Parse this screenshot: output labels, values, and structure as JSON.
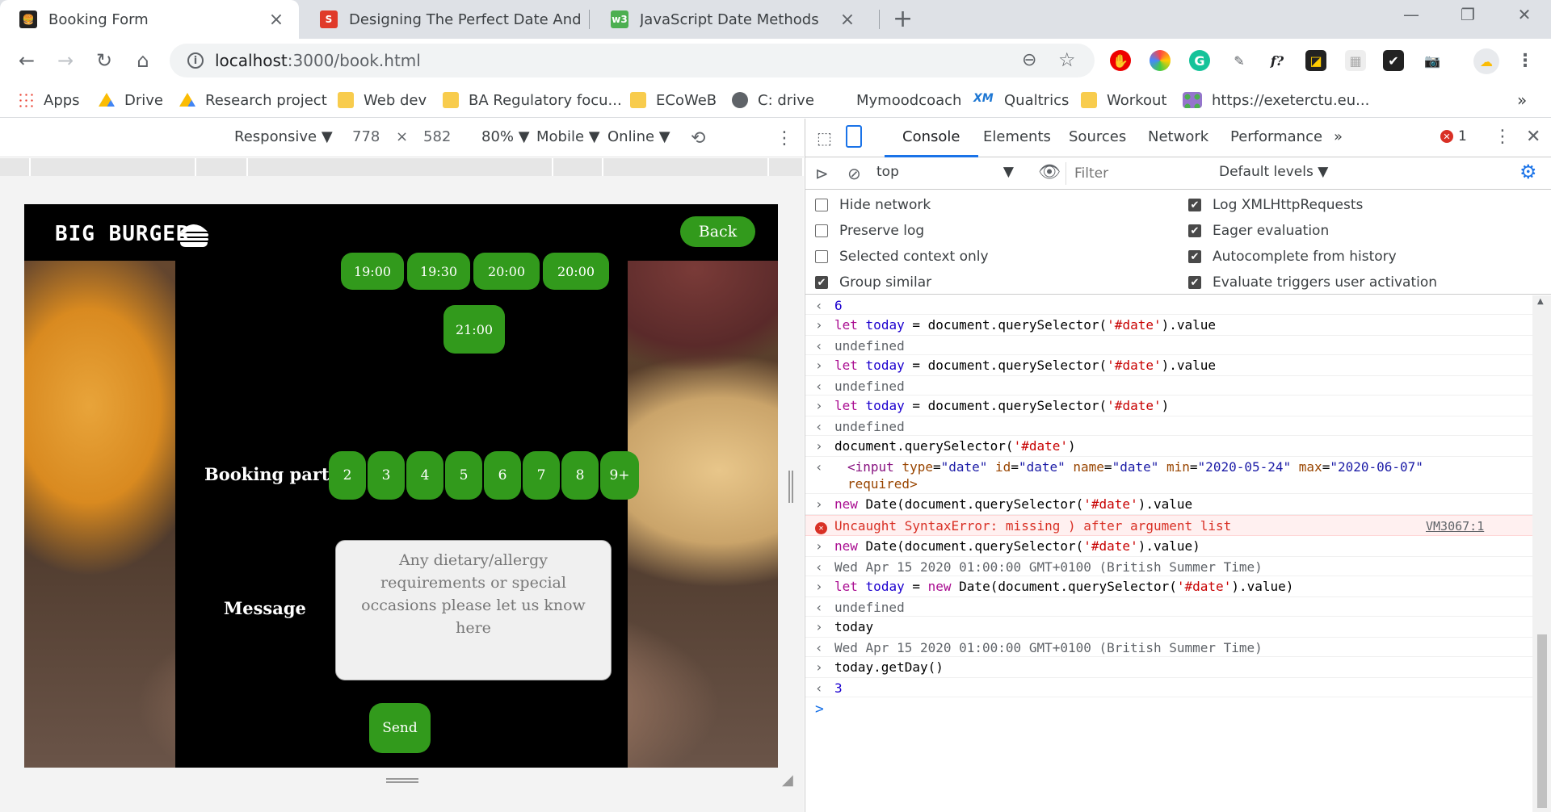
{
  "tabs": [
    {
      "title": "Booking Form",
      "active": true
    },
    {
      "title": "Designing The Perfect Date And",
      "active": false
    },
    {
      "title": "JavaScript Date Methods",
      "active": false
    }
  ],
  "address": {
    "host": "localhost",
    "rest": ":3000/book.html"
  },
  "bookmarks": [
    "Apps",
    "Drive",
    "Research project",
    "Web dev",
    "BA Regulatory focu...",
    "ECoWeB",
    "C: drive",
    "Mymoodcoach",
    "Qualtrics",
    "Workout",
    "https://exeterctu.eu..."
  ],
  "device": {
    "mode": "Responsive",
    "width": "778",
    "times": "×",
    "height": "582",
    "zoom": "80%",
    "type": "Mobile",
    "network": "Online"
  },
  "site": {
    "logo": "BIG BURGER",
    "back": "Back",
    "time_slots": [
      "19:00",
      "19:30",
      "20:00",
      "20:00",
      "21:00"
    ],
    "party_label": "Booking party",
    "party_sizes": [
      "2",
      "3",
      "4",
      "5",
      "6",
      "7",
      "8",
      "9+"
    ],
    "message_label": "Message",
    "message_placeholder": "Any dietary/allergy requirements or special occasions please let us know here",
    "send": "Send"
  },
  "devtools": {
    "tabs": [
      "Console",
      "Elements",
      "Sources",
      "Network",
      "Performance"
    ],
    "more": "»",
    "error_count": "1",
    "context": "top",
    "filter_placeholder": "Filter",
    "levels": "Default levels",
    "settings_left": [
      {
        "label": "Hide network",
        "checked": false
      },
      {
        "label": "Preserve log",
        "checked": false
      },
      {
        "label": "Selected context only",
        "checked": false
      },
      {
        "label": "Group similar",
        "checked": true
      }
    ],
    "settings_right": [
      {
        "label": "Log XMLHttpRequests",
        "checked": true
      },
      {
        "label": "Eager evaluation",
        "checked": true
      },
      {
        "label": "Autocomplete from history",
        "checked": true
      },
      {
        "label": "Evaluate triggers user activation",
        "checked": true
      }
    ],
    "console_lines": [
      {
        "kind": "out",
        "text": "6"
      },
      {
        "kind": "in",
        "text": "let today = document.querySelector('#date').value"
      },
      {
        "kind": "out",
        "text": "undefined"
      },
      {
        "kind": "in",
        "text": "let today = document.querySelector('#date').value"
      },
      {
        "kind": "out",
        "text": "undefined"
      },
      {
        "kind": "in",
        "text": "let today = document.querySelector('#date')"
      },
      {
        "kind": "out",
        "text": "undefined"
      },
      {
        "kind": "in",
        "text": "document.querySelector('#date')"
      },
      {
        "kind": "out",
        "text": "<input type=\"date\" id=\"date\" name=\"date\" min=\"2020-05-24\" max=\"2020-06-07\""
      },
      {
        "kind": "cont",
        "text": "required>"
      },
      {
        "kind": "in",
        "text": "new Date(document.querySelector('#date').value"
      },
      {
        "kind": "err",
        "text": "Uncaught SyntaxError: missing ) after argument list",
        "source": "VM3067:1"
      },
      {
        "kind": "in",
        "text": "new Date(document.querySelector('#date').value)"
      },
      {
        "kind": "out",
        "text": "Wed Apr 15 2020 01:00:00 GMT+0100 (British Summer Time)"
      },
      {
        "kind": "in",
        "text": "let today = new Date(document.querySelector('#date').value)"
      },
      {
        "kind": "out",
        "text": "undefined"
      },
      {
        "kind": "in",
        "text": "today"
      },
      {
        "kind": "out",
        "text": "Wed Apr 15 2020 01:00:00 GMT+0100 (British Summer Time)"
      },
      {
        "kind": "in",
        "text": "today.getDay()"
      },
      {
        "kind": "out",
        "text": "3"
      }
    ],
    "prompt": ">"
  }
}
